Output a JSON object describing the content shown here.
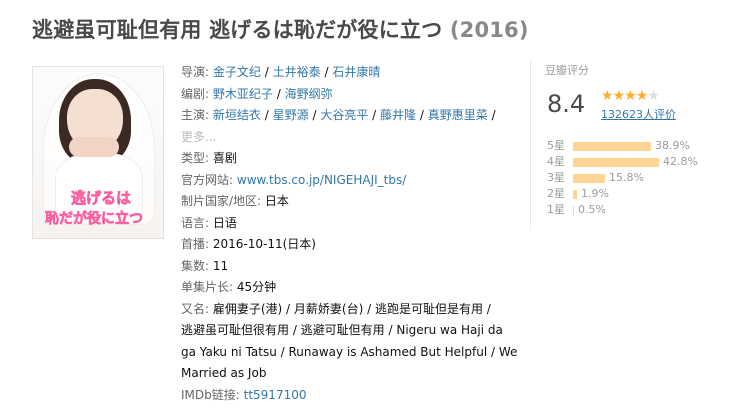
{
  "header": {
    "title": "逃避虽可耻但有用 逃げるは恥だが役に立つ",
    "year": "(2016)"
  },
  "poster": {
    "logo_line1": "逃げるは",
    "logo_line2": "恥だが役に立つ"
  },
  "info": {
    "director_label": "导演:",
    "directors": [
      "金子文纪",
      "土井裕泰",
      "石井康晴"
    ],
    "writer_label": "编剧:",
    "writers": [
      "野木亚纪子",
      "海野纲弥"
    ],
    "cast_label": "主演:",
    "cast": [
      "新垣结衣",
      "星野源",
      "大谷亮平",
      "藤井隆",
      "真野惠里菜"
    ],
    "more": "更多...",
    "genre_label": "类型:",
    "genre": "喜剧",
    "site_label": "官方网站:",
    "site": "www.tbs.co.jp/NIGEHAJI_tbs/",
    "country_label": "制片国家/地区:",
    "country": "日本",
    "language_label": "语言:",
    "language": "日语",
    "premiere_label": "首播:",
    "premiere": "2016-10-11(日本)",
    "episodes_label": "集数:",
    "episodes": "11",
    "runtime_label": "单集片长:",
    "runtime": "45分钟",
    "aka_label": "又名:",
    "aka_line1": "雇佣妻子(港) / 月薪娇妻(台) / 逃跑是可耻但是有用 /",
    "aka_line2": "逃避虽可耻但很有用 / 逃避可耻但有用 / Nigeru wa Haji da",
    "aka_line3": "ga Yaku ni Tatsu / Runaway is Ashamed But Helpful / We",
    "aka_line4": "Married as Job",
    "imdb_label": "IMDb链接:",
    "imdb": "tt5917100"
  },
  "rating": {
    "label": "豆瓣评分",
    "score": "8.4",
    "stars_filled": 4,
    "stars_total": 5,
    "count": "132623人评价",
    "distribution": [
      {
        "label": "5星",
        "pct": "38.9%",
        "value": 38.9
      },
      {
        "label": "4星",
        "pct": "42.8%",
        "value": 42.8
      },
      {
        "label": "3星",
        "pct": "15.8%",
        "value": 15.8
      },
      {
        "label": "2星",
        "pct": "1.9%",
        "value": 1.9
      },
      {
        "label": "1星",
        "pct": "0.5%",
        "value": 0.5
      }
    ]
  },
  "colors": {
    "link": "#3377aa",
    "star": "#ffac2d",
    "bar": "#ffd596",
    "title": "#494949"
  }
}
